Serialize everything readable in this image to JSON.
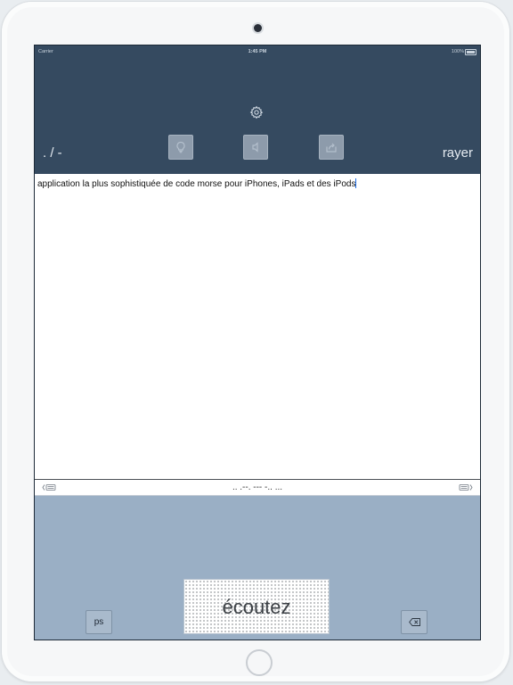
{
  "status_bar": {
    "carrier": "Carrier",
    "time": "1:45 PM",
    "battery": "100%"
  },
  "header": {
    "left_label": ". / -",
    "right_label": "rayer",
    "icons": [
      "gear-icon",
      "lightbulb-icon",
      "speaker-icon",
      "share-icon"
    ]
  },
  "editor": {
    "text": "application la plus sophistiquée de code morse pour iPhones, iPads et des iPods"
  },
  "morse_bar": {
    "morse": ".. .--. --- -.. ..."
  },
  "keypad": {
    "listen_label": "écoutez",
    "ps_label": "ps"
  },
  "colors": {
    "header_bg": "#354a60",
    "keypad_bg": "#9aafc5",
    "caret": "#1e6ee8"
  }
}
